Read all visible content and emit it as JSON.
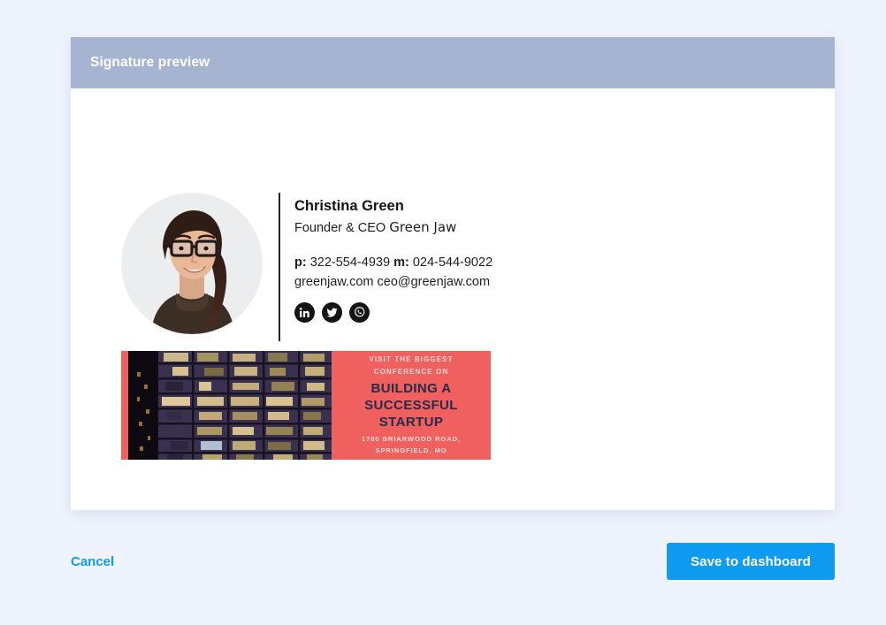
{
  "modal": {
    "header": {
      "title": "Signature preview",
      "bg_color": "#a6b4d2"
    }
  },
  "signature": {
    "avatar": {
      "icon": "portrait-photo-woman-glasses",
      "alt": "Portrait of Christina Green"
    },
    "name": "Christina Green",
    "role": "Founder & CEO",
    "company": "Green Jaw",
    "phone_label": "p:",
    "phone": "322-554-4939",
    "mobile_label": "m:",
    "mobile": "024-544-9022",
    "website": "greenjaw.com",
    "email": "ceo@greenjaw.com",
    "social": [
      {
        "name": "linkedin-icon",
        "label": "LinkedIn"
      },
      {
        "name": "twitter-icon",
        "label": "Twitter"
      },
      {
        "name": "whatsapp-icon",
        "label": "WhatsApp"
      }
    ],
    "banner": {
      "kicker_line1": "Visit the biggest",
      "kicker_line2": "Conference on",
      "headline_line1": "Building a",
      "headline_line2": "Successful",
      "headline_line3": "Startup",
      "address_line1": "1780  Briarwood Road,",
      "address_line2": "Springfield, MO",
      "accent_color": "#f0605e",
      "headline_color": "#262b4a",
      "image": "night-office-building-windows"
    }
  },
  "footer": {
    "cancel_label": "Cancel",
    "save_label": "Save to dashboard",
    "accent_color": "#0e9bf0"
  }
}
